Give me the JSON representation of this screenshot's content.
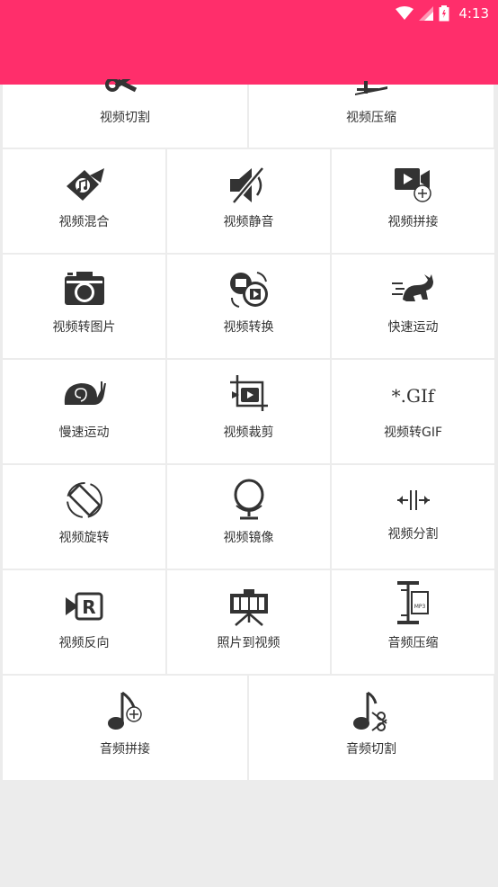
{
  "status_bar": {
    "time": "4:13",
    "color": "#ff2e6b"
  },
  "tools_top": [
    {
      "label": "视频切割",
      "icon": "scissors-icon"
    },
    {
      "label": "视频压缩",
      "icon": "video-compress-icon"
    }
  ],
  "tools": [
    {
      "label": "视频混合",
      "icon": "video-music-mix-icon"
    },
    {
      "label": "视频静音",
      "icon": "mute-icon"
    },
    {
      "label": "视频拼接",
      "icon": "video-join-icon"
    },
    {
      "label": "视频转图片",
      "icon": "camera-icon"
    },
    {
      "label": "视频转换",
      "icon": "video-convert-icon"
    },
    {
      "label": "快速运动",
      "icon": "rabbit-icon"
    },
    {
      "label": "慢速运动",
      "icon": "snail-icon"
    },
    {
      "label": "视频裁剪",
      "icon": "crop-video-icon"
    },
    {
      "label": "视频转GIF",
      "icon": "gif-icon",
      "icon_text": "*.GIf"
    },
    {
      "label": "视频旋转",
      "icon": "rotate-icon"
    },
    {
      "label": "视频镜像",
      "icon": "mirror-icon"
    },
    {
      "label": "视频分割",
      "icon": "split-icon"
    },
    {
      "label": "视频反向",
      "icon": "reverse-icon",
      "icon_text": "R"
    },
    {
      "label": "照片到视频",
      "icon": "photo-to-video-icon"
    },
    {
      "label": "音频压缩",
      "icon": "audio-compress-icon",
      "icon_text": "MP3"
    }
  ],
  "tools_bottom": [
    {
      "label": "音频拼接",
      "icon": "audio-join-icon"
    },
    {
      "label": "音频切割",
      "icon": "audio-cut-icon"
    }
  ]
}
